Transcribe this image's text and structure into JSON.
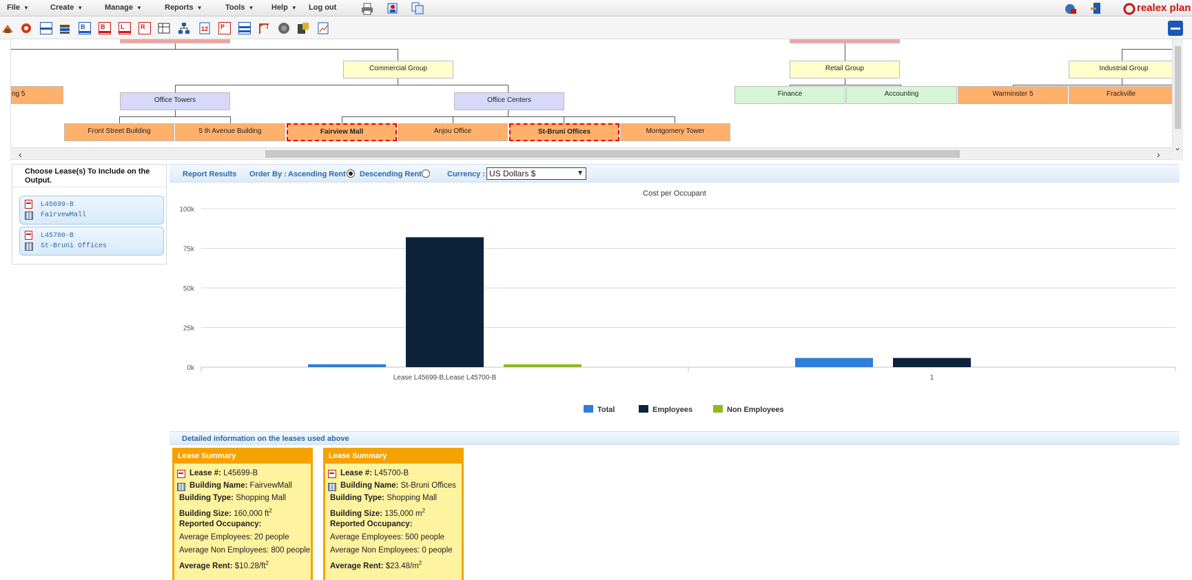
{
  "menu": {
    "items": [
      "File",
      "Create",
      "Manage",
      "Reports",
      "Tools",
      "Help",
      "Log out"
    ],
    "brand": "realex plan"
  },
  "toolbar": {
    "icons": [
      "buildings-icon",
      "gear-icon",
      "document-icon",
      "books-icon",
      "report-b-icon",
      "report-b-red-icon",
      "report-l-icon",
      "report-settings-icon",
      "report-grid-icon",
      "org-chart-icon",
      "report-sort-icon",
      "report-p-icon",
      "report-list-icon",
      "crane-icon",
      "globe-icon",
      "calculator-icon",
      "report-chart-icon"
    ]
  },
  "orgchart": {
    "top_level": [
      "Commercial Group",
      "Retail Group",
      "Industrial Group"
    ],
    "commercial_children": [
      "Office Towers",
      "Office Centers"
    ],
    "leaf_partial": "ng 5",
    "office_towers_children": [
      "Front Street Building",
      "5 th Avenue Building"
    ],
    "office_centers_children": [
      "Fairview Mall",
      "Anjou Office",
      "St-Bruni Offices",
      "Montgomery Tower"
    ],
    "retail_children": [
      "Finance",
      "Accounting"
    ],
    "industrial_children": [
      "Warminster 5",
      "Frackville"
    ]
  },
  "lease_panel": {
    "title": "Choose Lease(s) To Include on the Output.",
    "leases": [
      {
        "id": "L45699-B",
        "building": "FairvewMall"
      },
      {
        "id": "L45700-B",
        "building": "St-Bruni Offices"
      }
    ]
  },
  "report_bar": {
    "results_label": "Report Results",
    "order_by_label": "Order By :",
    "asc_label": "Ascending Rent",
    "desc_label": "Descending Rent",
    "selected_order": "ascending",
    "currency_label": "Currency :",
    "currency_value": "US Dollars $"
  },
  "chart_data": {
    "type": "bar",
    "title": "Cost per Occupant",
    "categories": [
      "Lease L45699-B,Lease L45700-B",
      "1"
    ],
    "series": [
      {
        "name": "Total",
        "color": "#2f7ed8",
        "values": [
          1800,
          5800
        ]
      },
      {
        "name": "Employees",
        "color": "#0d233a",
        "values": [
          82000,
          5800
        ]
      },
      {
        "name": "Non Employees",
        "color": "#8bbc21",
        "values": [
          1800,
          0
        ]
      }
    ],
    "ylim": [
      0,
      100000
    ],
    "yticks": [
      "0k",
      "25k",
      "50k",
      "75k",
      "100k"
    ],
    "ytick_values": [
      0,
      25000,
      50000,
      75000,
      100000
    ],
    "grid": true,
    "legend": "bottom-center"
  },
  "details": {
    "title": "Detailed information on the leases used above",
    "cards": [
      {
        "header": "Lease Summary",
        "lease_label": "Lease #:",
        "lease": "L45699-B",
        "bname_label": "Building Name:",
        "bname": "FairvewMall",
        "btype_label": "Building Type:",
        "btype": "Shopping Mall",
        "bsize_label": "Building Size:",
        "bsize": "160,000 ft",
        "size_exp": "2",
        "occ_label": "Reported Occupancy:",
        "emp": "Average Employees: 20 people",
        "nonemp": "Average Non Employees: 800 people",
        "rent_label": "Average Rent:",
        "rent": "$10.28/ft",
        "rent_exp": "2"
      },
      {
        "header": "Lease Summary",
        "lease_label": "Lease #:",
        "lease": "L45700-B",
        "bname_label": "Building Name:",
        "bname": "St-Bruni Offices",
        "btype_label": "Building Type:",
        "btype": "Shopping Mall",
        "bsize_label": "Building Size:",
        "bsize": "135,000 m",
        "size_exp": "2",
        "occ_label": "Reported Occupancy:",
        "emp": "Average Employees: 500 people",
        "nonemp": "Average Non Employees: 0 people",
        "rent_label": "Average Rent:",
        "rent": "$23.48/m",
        "rent_exp": "2"
      }
    ]
  }
}
